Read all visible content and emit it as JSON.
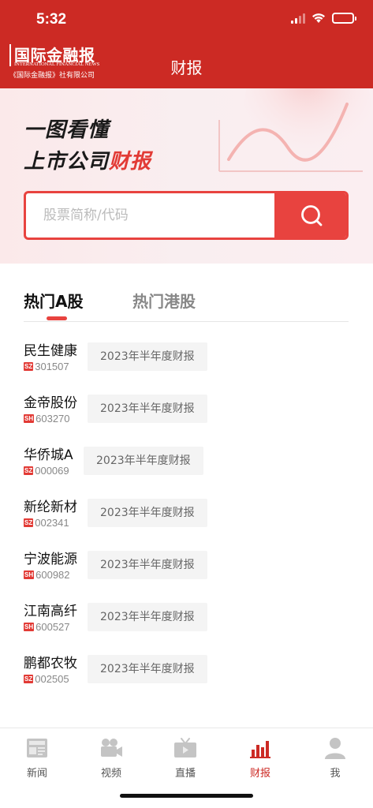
{
  "status_bar": {
    "time": "5:32"
  },
  "header": {
    "logo_cn": "国际金融报",
    "logo_en": "INTERNATIONAL FINANCIAL NEWS",
    "logo_company": "《国际金融报》社有限公司",
    "title": "财报"
  },
  "banner": {
    "line1": "一图看懂",
    "line2_prefix": "上市公司",
    "line2_highlight": "财报"
  },
  "search": {
    "placeholder": "股票简称/代码"
  },
  "tabs": [
    {
      "label": "热门A股",
      "active": true
    },
    {
      "label": "热门港股",
      "active": false
    }
  ],
  "stocks": [
    {
      "name": "民生健康",
      "market": "SZ",
      "code": "301507",
      "report": "2023年半年度财报"
    },
    {
      "name": "金帝股份",
      "market": "SH",
      "code": "603270",
      "report": "2023年半年度财报"
    },
    {
      "name": "华侨城A",
      "market": "SZ",
      "code": "000069",
      "report": "2023年半年度财报"
    },
    {
      "name": "新纶新材",
      "market": "SZ",
      "code": "002341",
      "report": "2023年半年度财报"
    },
    {
      "name": "宁波能源",
      "market": "SH",
      "code": "600982",
      "report": "2023年半年度财报"
    },
    {
      "name": "江南高纤",
      "market": "SH",
      "code": "600527",
      "report": "2023年半年度财报"
    },
    {
      "name": "鹏都农牧",
      "market": "SZ",
      "code": "002505",
      "report": "2023年半年度财报"
    }
  ],
  "bottom_nav": [
    {
      "label": "新闻",
      "icon": "newspaper-icon",
      "active": false
    },
    {
      "label": "视频",
      "icon": "video-camera-icon",
      "active": false
    },
    {
      "label": "直播",
      "icon": "tv-icon",
      "active": false
    },
    {
      "label": "财报",
      "icon": "bar-chart-icon",
      "active": true
    },
    {
      "label": "我",
      "icon": "user-icon",
      "active": false
    }
  ],
  "colors": {
    "brand_red": "#cc2a24",
    "accent_red": "#e8433f",
    "inactive_gray": "#bfbfbf"
  }
}
